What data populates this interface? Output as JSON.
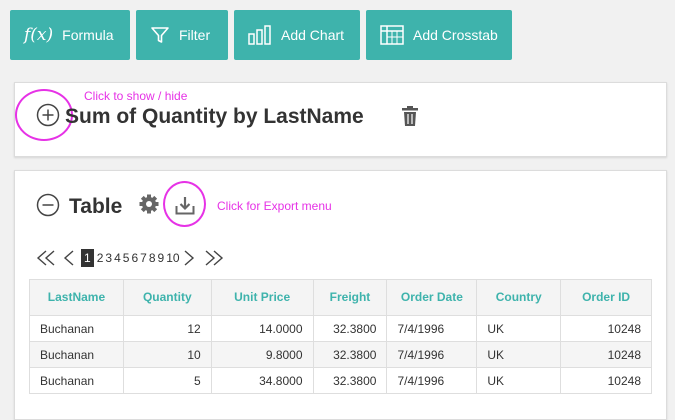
{
  "toolbar": {
    "formula_icon": "f(x)",
    "formula_label": "Formula",
    "filter_label": "Filter",
    "add_chart_label": "Add Chart",
    "add_crosstab_label": "Add Crosstab"
  },
  "summary_panel": {
    "title": "Sum of Quantity by LastName",
    "annotation": "Click to show / hide",
    "toggle_icon": "plus-circle-icon",
    "delete_icon": "trash-icon"
  },
  "table_panel": {
    "title": "Table",
    "annotation": "Click for Export menu",
    "toggle_icon": "minus-circle-icon",
    "settings_icon": "gear-icon",
    "export_icon": "download-icon"
  },
  "pager": {
    "active_page": "1",
    "pages": [
      "2",
      "3",
      "4",
      "5",
      "6",
      "7",
      "8",
      "9",
      "10"
    ]
  },
  "table": {
    "headers": [
      "LastName",
      "Quantity",
      "Unit Price",
      "Freight",
      "Order Date",
      "Country",
      "Order ID"
    ],
    "rows": [
      [
        "Buchanan",
        "12",
        "14.0000",
        "32.3800",
        "7/4/1996",
        "UK",
        "10248"
      ],
      [
        "Buchanan",
        "10",
        "9.8000",
        "32.3800",
        "7/4/1996",
        "UK",
        "10248"
      ],
      [
        "Buchanan",
        "5",
        "34.8000",
        "32.3800",
        "7/4/1996",
        "UK",
        "10248"
      ]
    ]
  },
  "colors": {
    "accent": "#3eb3ac",
    "annotation": "#e632e6",
    "title": "#333333"
  }
}
